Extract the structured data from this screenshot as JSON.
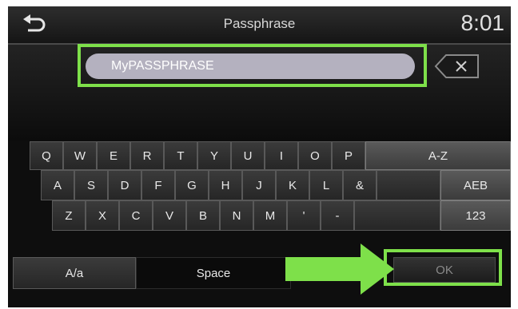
{
  "header": {
    "title": "Passphrase",
    "clock": "8:01",
    "back_icon": "back-arrow-icon"
  },
  "input": {
    "value": "MyPASSPHRASE",
    "backspace_icon": "backspace-icon"
  },
  "keyboard": {
    "row1": [
      "Q",
      "W",
      "E",
      "R",
      "T",
      "Y",
      "U",
      "I",
      "O",
      "P",
      "A-Z"
    ],
    "row2": [
      "A",
      "S",
      "D",
      "F",
      "G",
      "H",
      "J",
      "K",
      "L",
      "&",
      "AEB"
    ],
    "row3": [
      "Z",
      "X",
      "C",
      "V",
      "B",
      "N",
      "M",
      "'",
      "-",
      "123"
    ],
    "row4": {
      "case": "A/a",
      "space": "Space",
      "ok": "OK"
    }
  },
  "annotation": {
    "highlight_color": "#7ee04a",
    "pointer_icon": "green-arrow-icon"
  }
}
